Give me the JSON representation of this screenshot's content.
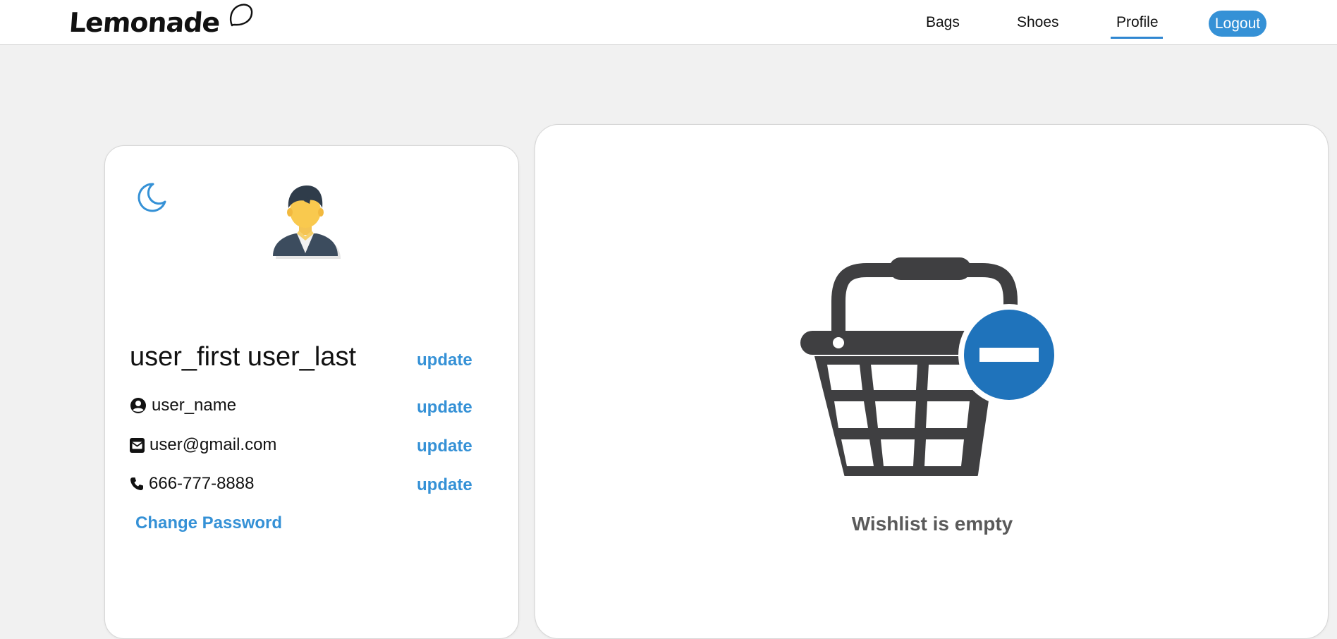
{
  "header": {
    "brand": "Lemonade",
    "nav": {
      "bags": "Bags",
      "shoes": "Shoes",
      "profile": "Profile",
      "logout": "Logout"
    },
    "active_nav": "Profile"
  },
  "profile": {
    "theme_toggle_icon": "moon-icon",
    "avatar_icon": "user-avatar-icon",
    "full_name": "user_first user_last",
    "username": "user_name",
    "email": "user@gmail.com",
    "phone": "666-777-8888",
    "update_label": "update",
    "change_password": "Change Password"
  },
  "wishlist": {
    "icon": "basket-remove-icon",
    "empty_message": "Wishlist is empty"
  },
  "colors": {
    "accent": "#3591d6",
    "basket": "#3f3f41",
    "basket_badge": "#1f73bb",
    "background": "#f1f1f1"
  }
}
